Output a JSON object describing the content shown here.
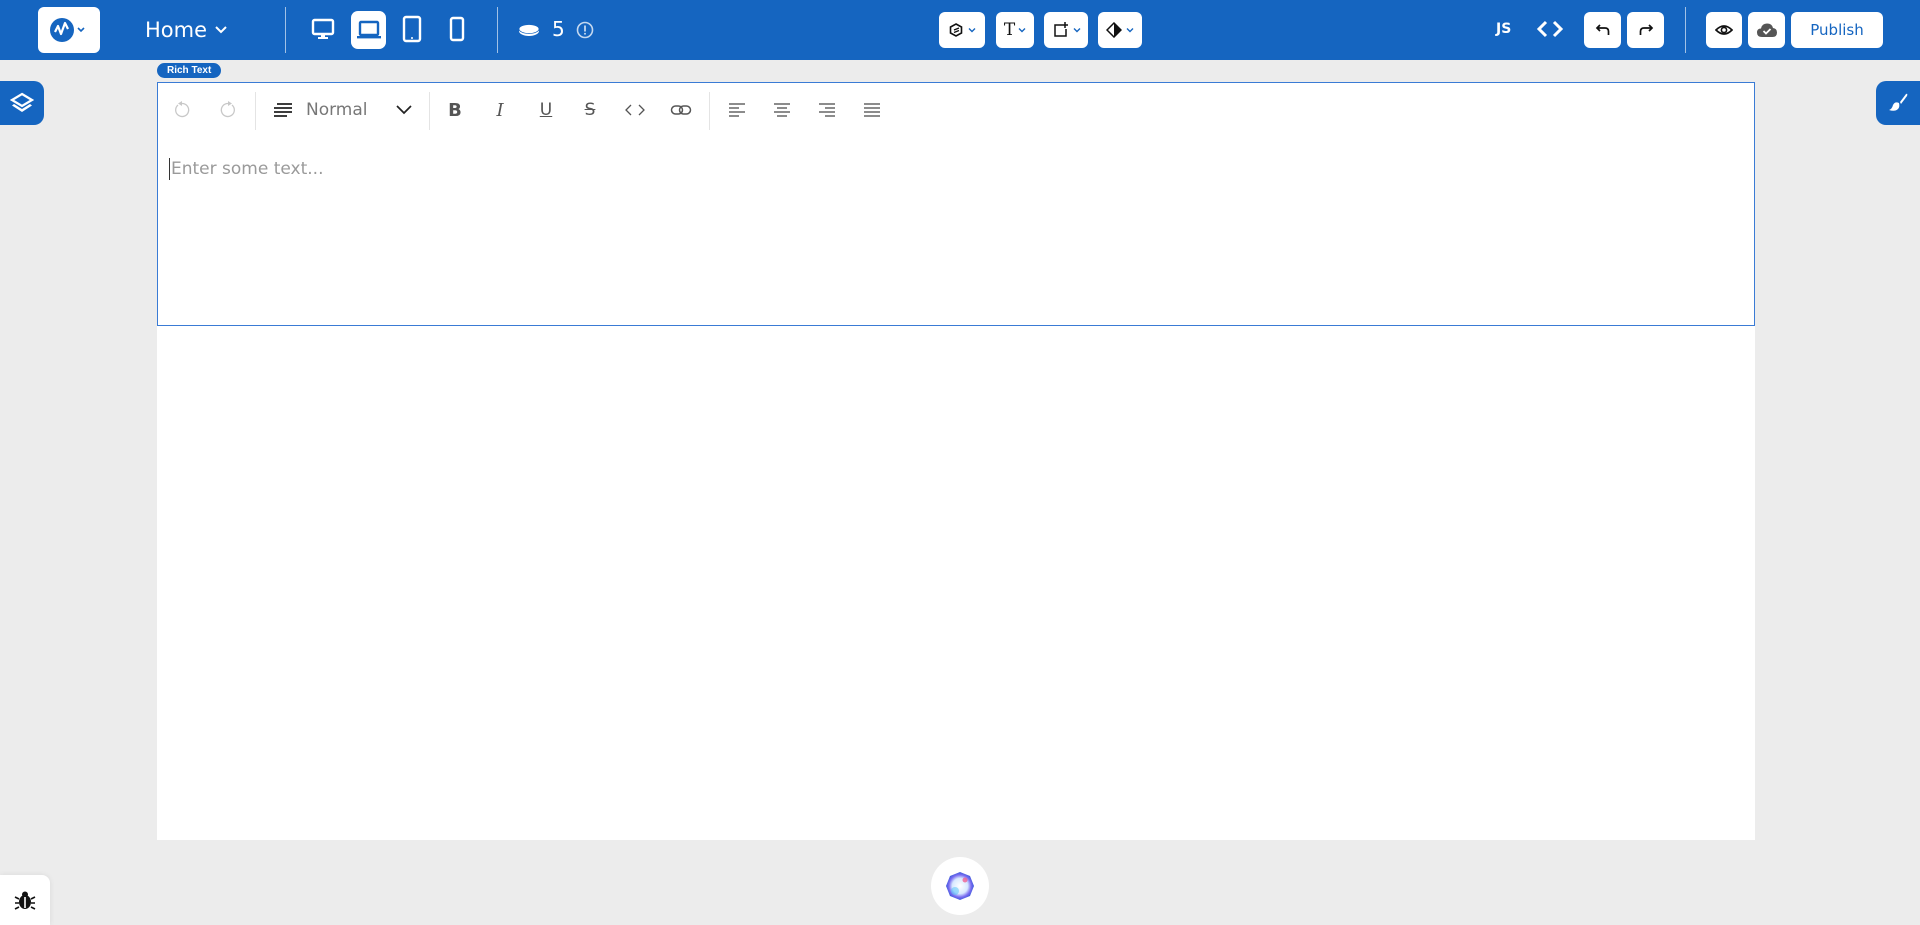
{
  "header": {
    "page_selector": "Home",
    "credits": "5",
    "js_label": "JS",
    "publish_label": "Publish",
    "devices": [
      {
        "name": "desktop",
        "active": false
      },
      {
        "name": "laptop",
        "active": true
      },
      {
        "name": "tablet",
        "active": false
      },
      {
        "name": "mobile",
        "active": false
      }
    ],
    "insert_menus": [
      "components-icon",
      "text-icon",
      "add-element-icon",
      "theme-contrast-icon"
    ]
  },
  "editor": {
    "badge": "Rich Text",
    "format_select": "Normal",
    "placeholder": "Enter some text..."
  },
  "colors": {
    "brand": "#1565c0",
    "canvas_bg": "#ececec",
    "selection_border": "#3a7bd5"
  }
}
